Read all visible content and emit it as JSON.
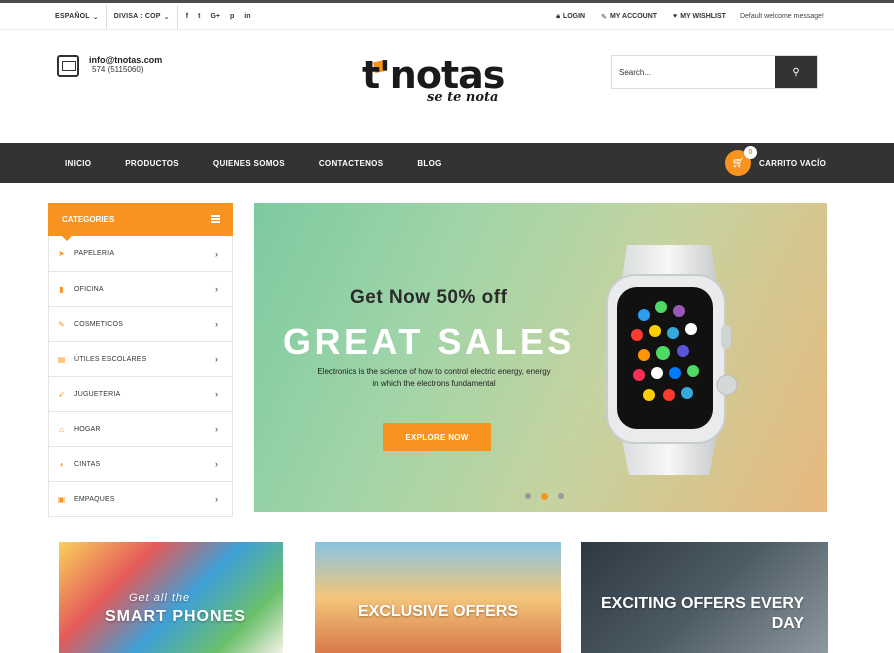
{
  "topbar": {
    "language": "ESPAÑOL",
    "currency": "DIVISA : COP",
    "social_icons": [
      "facebook-icon",
      "twitter-icon",
      "google-plus-icon",
      "pinterest-icon",
      "linkedin-icon"
    ],
    "social_glyphs": [
      "f",
      "t",
      "G+",
      "p",
      "in"
    ],
    "login": "LOGIN",
    "my_account": "MY ACCOUNT",
    "my_wishlist": "MY WISHLIST",
    "welcome": "Default welcome message!"
  },
  "header": {
    "email": "info@tnotas.com",
    "phone": "574 (5115060)",
    "logo_main": "t'notas",
    "logo_sub": "se te nota",
    "search_placeholder": "Search..."
  },
  "nav": {
    "items": [
      "INICIO",
      "PRODUCTOS",
      "QUIENES SOMOS",
      "CONTACTENOS",
      "BLOG"
    ]
  },
  "cart": {
    "count": "0",
    "label": "CARRITO  VACÍO"
  },
  "categories": {
    "title": "CATEGORIES",
    "items": [
      {
        "label": "PAPELERIA",
        "icon": "paper-plane-icon"
      },
      {
        "label": "OFICINA",
        "icon": "book-icon"
      },
      {
        "label": "COSMETICOS",
        "icon": "brush-icon"
      },
      {
        "label": "ÚTILES ESCOLARES",
        "icon": "books-icon"
      },
      {
        "label": "JUGUETERIA",
        "icon": "rocket-icon"
      },
      {
        "label": "HOGAR",
        "icon": "home-icon"
      },
      {
        "label": "CINTAS",
        "icon": "tape-icon"
      },
      {
        "label": "EMPAQUES",
        "icon": "gift-icon"
      }
    ]
  },
  "hero": {
    "subtitle": "Get Now 50% off",
    "title": "GREAT SALES",
    "description": "Electronics is the science of how to control electric energy, energy in which the electrons fundamental",
    "cta": "EXPLORE NOW",
    "active_slide": 2,
    "slides": 3
  },
  "banners": [
    {
      "caption_small": "Get all the",
      "caption": "SMART PHONES"
    },
    {
      "caption": "EXCLUSIVE OFFERS"
    },
    {
      "caption": "EXCITING OFFERS EVERY DAY"
    }
  ],
  "colors": {
    "accent": "#f7931e",
    "dark": "#333333"
  }
}
